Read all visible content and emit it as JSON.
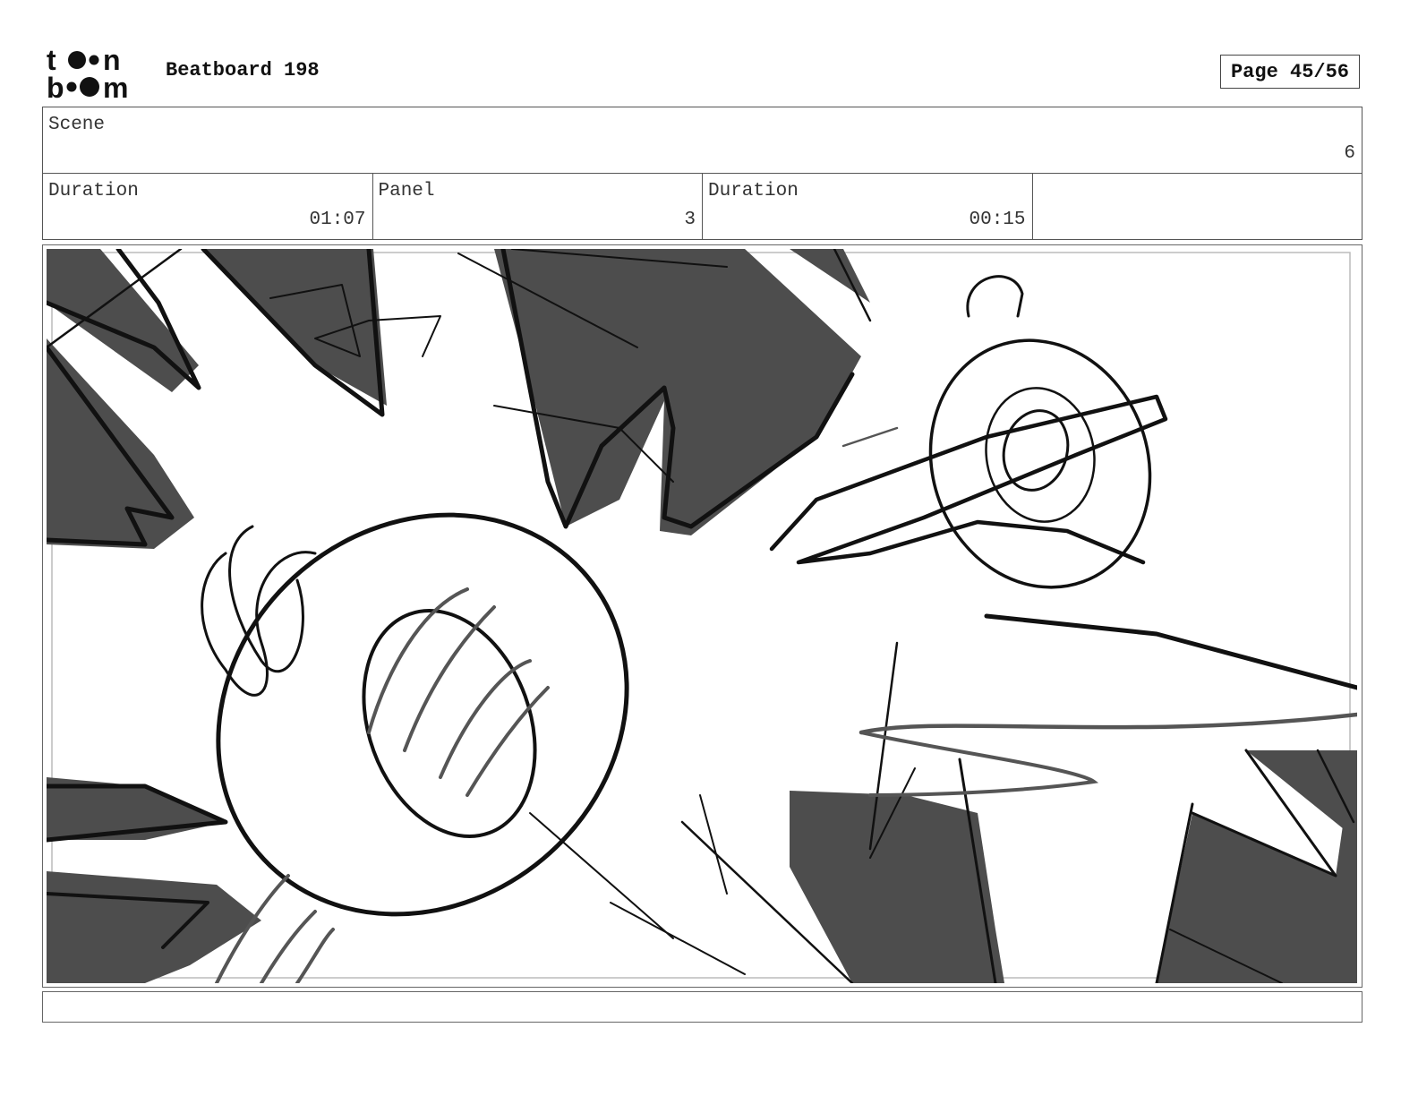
{
  "header": {
    "brand": "toon boom",
    "title": "Beatboard 198",
    "page_label": "Page 45/56"
  },
  "scene": {
    "label": "Scene",
    "value": "6"
  },
  "fields": [
    {
      "label": "Duration",
      "value": "01:07"
    },
    {
      "label": "Panel",
      "value": "3"
    },
    {
      "label": "Duration",
      "value": "00:15"
    },
    {
      "label": "",
      "value": ""
    }
  ],
  "colors": {
    "ink": "#111111",
    "shadow": "#4d4d4d",
    "frame": "#666666"
  },
  "caption": ""
}
